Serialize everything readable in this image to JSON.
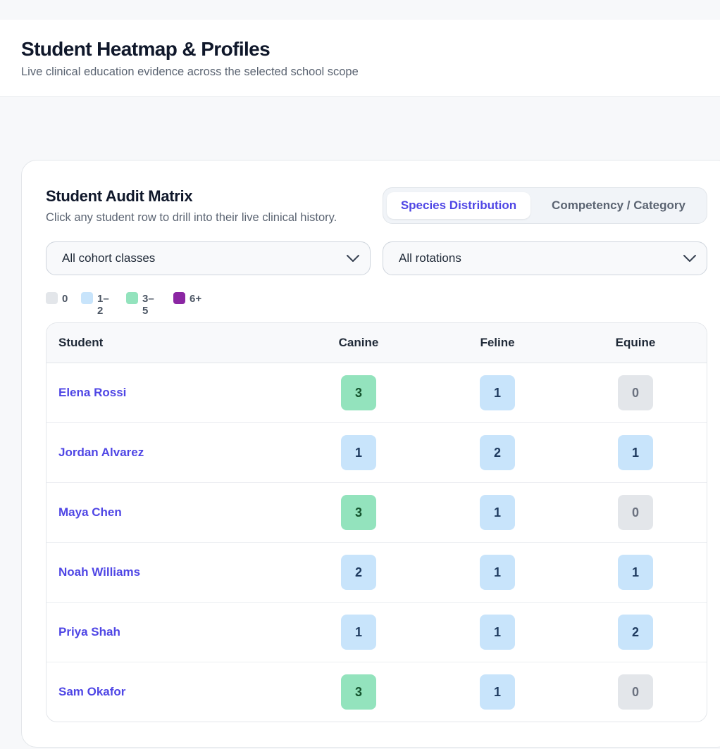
{
  "header": {
    "title": "Student Heatmap & Profiles",
    "subtitle": "Live clinical education evidence across the selected school scope"
  },
  "card": {
    "title": "Student Audit Matrix",
    "subtitle": "Click any student row to drill into their live clinical history."
  },
  "view_toggle": {
    "active": "Species Distribution",
    "inactive": "Competency / Category"
  },
  "filters": {
    "cohort": "All cohort classes",
    "rotation": "All rotations"
  },
  "legend": [
    {
      "label": "0",
      "color": "#e3e6ea"
    },
    {
      "label": "1–2",
      "color": "#c8e4fb"
    },
    {
      "label": "3–5",
      "color": "#93e3bd"
    },
    {
      "label": "6+",
      "color": "#8b26a3"
    }
  ],
  "table": {
    "headers": [
      "Student",
      "Canine",
      "Feline",
      "Equine"
    ],
    "rows": [
      {
        "name": "Elena Rossi",
        "values": [
          3,
          1,
          0
        ]
      },
      {
        "name": "Jordan Alvarez",
        "values": [
          1,
          2,
          1
        ]
      },
      {
        "name": "Maya Chen",
        "values": [
          3,
          1,
          0
        ]
      },
      {
        "name": "Noah Williams",
        "values": [
          2,
          1,
          1
        ]
      },
      {
        "name": "Priya Shah",
        "values": [
          1,
          1,
          2
        ]
      },
      {
        "name": "Sam Okafor",
        "values": [
          3,
          1,
          0
        ]
      }
    ]
  },
  "colors": {
    "accent": "#4f46e5",
    "level_0": "#e3e6ea",
    "level_1_2": "#c8e4fb",
    "level_3_5": "#93e3bd",
    "level_6_plus": "#8b26a3"
  }
}
